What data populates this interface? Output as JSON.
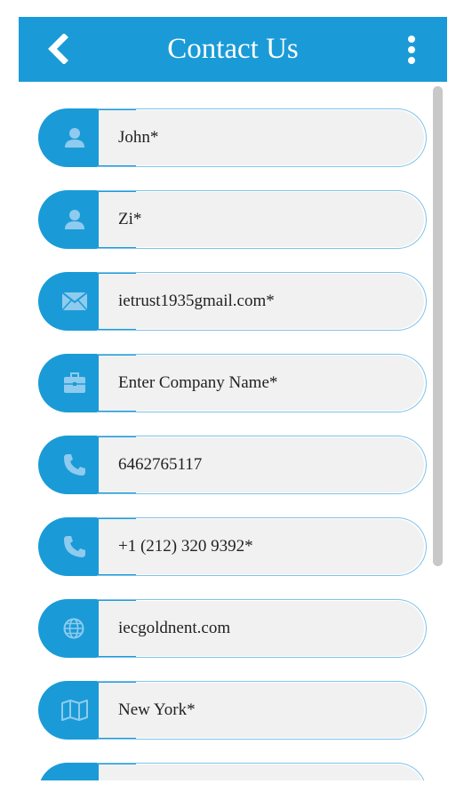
{
  "app_bar": {
    "title": "Contact Us",
    "back_icon": "chevron-left-icon",
    "menu_icon": "more-vertical-icon",
    "color": "#1a9bd7"
  },
  "form": {
    "fields": [
      {
        "icon": "person-icon",
        "value": "John*"
      },
      {
        "icon": "person-icon",
        "value": "Zi*"
      },
      {
        "icon": "envelope-icon",
        "value": "ietrust1935gmail.com*"
      },
      {
        "icon": "briefcase-icon",
        "value": "Enter Company Name*"
      },
      {
        "icon": "phone-icon",
        "value": "6462765117"
      },
      {
        "icon": "phone-icon",
        "value": "+1 (212) 320 9392*"
      },
      {
        "icon": "globe-icon",
        "value": "iecgoldnent.com"
      },
      {
        "icon": "map-icon",
        "value": "New York*"
      },
      {
        "icon": "partial-field",
        "value": ""
      }
    ]
  },
  "colors": {
    "accent": "#1a9bd7",
    "field_fill": "#f1f1f1",
    "field_border": "#7fc3ea",
    "icon_tint": "#7fc3ea"
  }
}
